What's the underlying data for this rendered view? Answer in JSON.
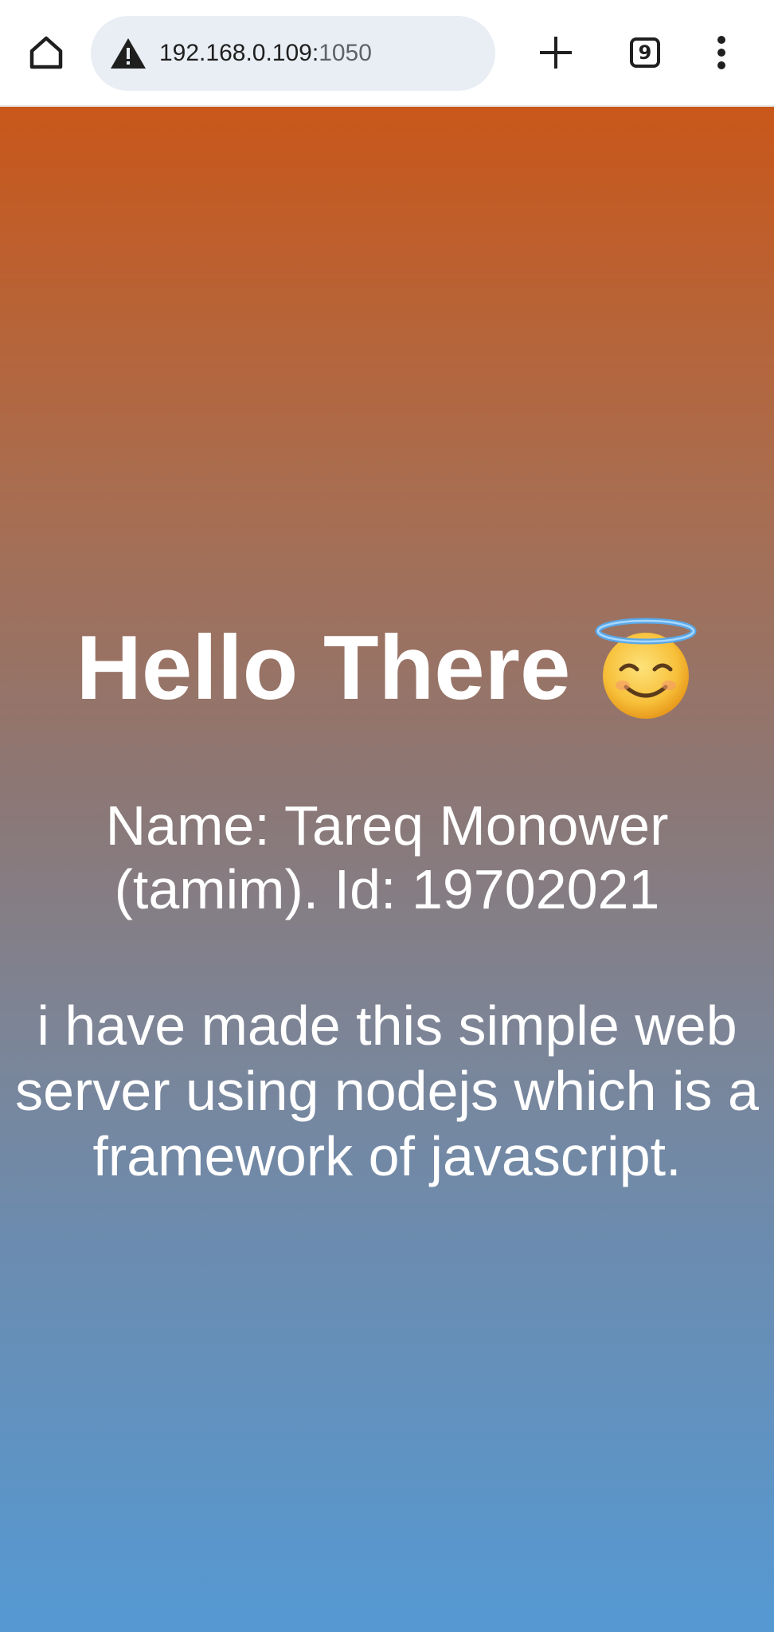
{
  "browser": {
    "url_host": "192.168.0.109:",
    "url_port": "1050",
    "tab_count": "9",
    "icons": {
      "home": "home-icon",
      "warning": "warning-icon",
      "new_tab": "plus-icon",
      "tabs": "tab-switcher-icon",
      "menu": "more-vertical-icon"
    }
  },
  "page": {
    "heading": "Hello There",
    "heading_emoji": "smiling-face-with-halo",
    "name_line_1": "Name: Tareq Monower",
    "name_line_2": "(tamim). Id: 19702021",
    "desc_line_1": "i have made this simple web",
    "desc_line_2": "server using nodejs which is a",
    "desc_line_3": "framework of javascript.",
    "colors": {
      "gradient_top": "#c9571a",
      "gradient_bottom": "#5599d3",
      "text": "#ffffff"
    }
  }
}
